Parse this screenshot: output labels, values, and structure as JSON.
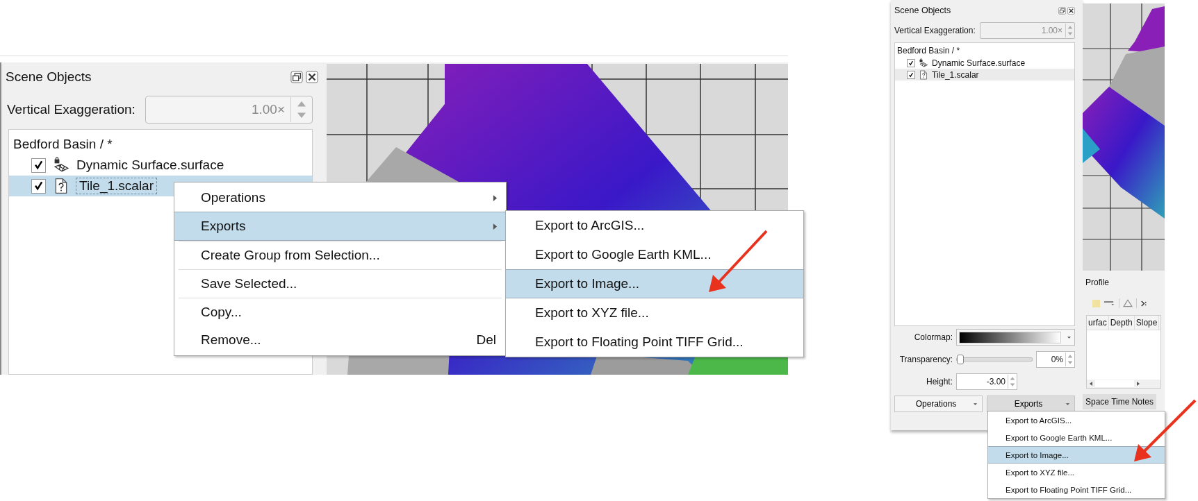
{
  "zoomed_view": {
    "panel": {
      "title": "Scene Objects",
      "exaggeration": {
        "label": "Vertical Exaggeration:",
        "value": "1.00×",
        "disabled": true
      },
      "tree": {
        "root": "Bedford Basin / *",
        "items": [
          {
            "label": "Dynamic Surface.surface",
            "kind": "surface",
            "checked": true,
            "selected": false
          },
          {
            "label": "Tile_1.scalar",
            "kind": "scalar",
            "checked": true,
            "selected": true
          }
        ]
      }
    },
    "context_menu": {
      "groups": [
        [
          {
            "label": "Operations",
            "submenu": true,
            "selected": false
          },
          {
            "label": "Exports",
            "submenu": true,
            "selected": true
          }
        ],
        [
          {
            "label": "Create Group from Selection...",
            "submenu": false,
            "selected": false
          }
        ],
        [
          {
            "label": "Save Selected...",
            "submenu": false,
            "selected": false
          }
        ],
        [
          {
            "label": "Copy...",
            "submenu": false,
            "selected": false
          },
          {
            "label": "Remove...",
            "submenu": false,
            "selected": false,
            "shortcut": "Del"
          }
        ]
      ]
    },
    "submenu": [
      {
        "label": "Export to ArcGIS...",
        "selected": false
      },
      {
        "label": "Export to Google Earth KML...",
        "selected": false
      },
      {
        "label": "Export to Image...",
        "selected": true
      },
      {
        "label": "Export to XYZ file...",
        "selected": false
      },
      {
        "label": "Export to Floating Point TIFF Grid...",
        "selected": false
      }
    ]
  },
  "full_view": {
    "panel": {
      "title": "Scene Objects",
      "exaggeration": {
        "label": "Vertical Exaggeration:",
        "value": "1.00×",
        "disabled": true
      },
      "tree": {
        "root": "Bedford Basin / *",
        "items": [
          {
            "label": "Dynamic Surface.surface",
            "kind": "surface",
            "checked": true,
            "selected": false
          },
          {
            "label": "Tile_1.scalar",
            "kind": "scalar",
            "checked": true,
            "selected": true
          }
        ]
      },
      "colormap": {
        "label": "Colormap:"
      },
      "transparency": {
        "label": "Transparency:",
        "level": 0,
        "value": "0%"
      },
      "height": {
        "label": "Height:",
        "value": "-3.00"
      },
      "buttons": [
        {
          "label": "Operations",
          "pressed": false
        },
        {
          "label": "Exports",
          "pressed": true
        }
      ]
    },
    "dropdown": [
      {
        "label": "Export to ArcGIS...",
        "selected": false
      },
      {
        "label": "Export to Google Earth KML...",
        "selected": false
      },
      {
        "label": "Export to Image...",
        "selected": true
      },
      {
        "label": "Export to XYZ file...",
        "selected": false
      },
      {
        "label": "Export to Floating Point TIFF Grid...",
        "selected": false
      }
    ],
    "profile": {
      "title": "Profile",
      "columns": [
        "urfac",
        "Depth",
        "Slope"
      ]
    },
    "tab": "Space Time Notes"
  }
}
